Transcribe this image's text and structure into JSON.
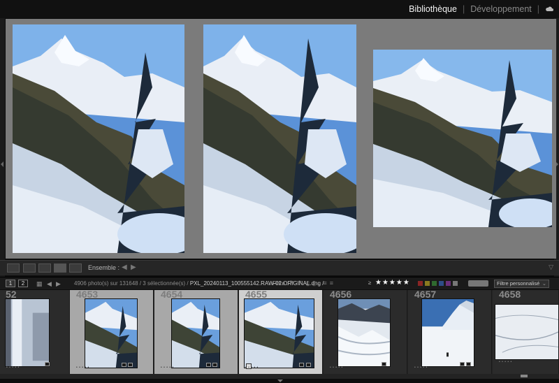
{
  "modules": {
    "library": "Bibliothèque",
    "develop": "Développement"
  },
  "toolbar": {
    "ensemble_label": "Ensemble :"
  },
  "filmstrip_bar": {
    "screen1": "1",
    "screen2": "2",
    "info_count": "4906 photo(s) sur 131648 / 3 sélectionnée(s) /",
    "info_file": "PXL_20240113_100555142.RAW-02.ORIGINAL.dng /",
    "filter_label": "Filtre :",
    "rating_op": "≥",
    "stars": "★★★★★",
    "custom_filter": "Filtre personnalisé",
    "colors": [
      "#8a2525",
      "#8a7a20",
      "#2f6a2f",
      "#2e4d88",
      "#6b2f7a",
      "#777777"
    ]
  },
  "filmstrip": {
    "cells": [
      {
        "number": "52",
        "stars": "• • • • •",
        "state": "normal"
      },
      {
        "number": "4653",
        "stars": "• • • • •",
        "state": "selected"
      },
      {
        "number": "4654",
        "stars": "• • • • •",
        "state": "selected"
      },
      {
        "number": "4655",
        "stars": "• • • • •",
        "state": "current"
      },
      {
        "number": "4656",
        "stars": "• • • • •",
        "state": "normal"
      },
      {
        "number": "4657",
        "stars": "• • • • •",
        "state": "normal"
      },
      {
        "number": "4658",
        "stars": "• • • • •",
        "state": "normal"
      }
    ]
  },
  "icons": {
    "cloud": "cloud-icon",
    "grid": "grid-view-icon",
    "loupe": "loupe-view-icon",
    "compare": "compare-view-icon",
    "survey": "survey-view-icon",
    "people": "people-view-icon"
  }
}
